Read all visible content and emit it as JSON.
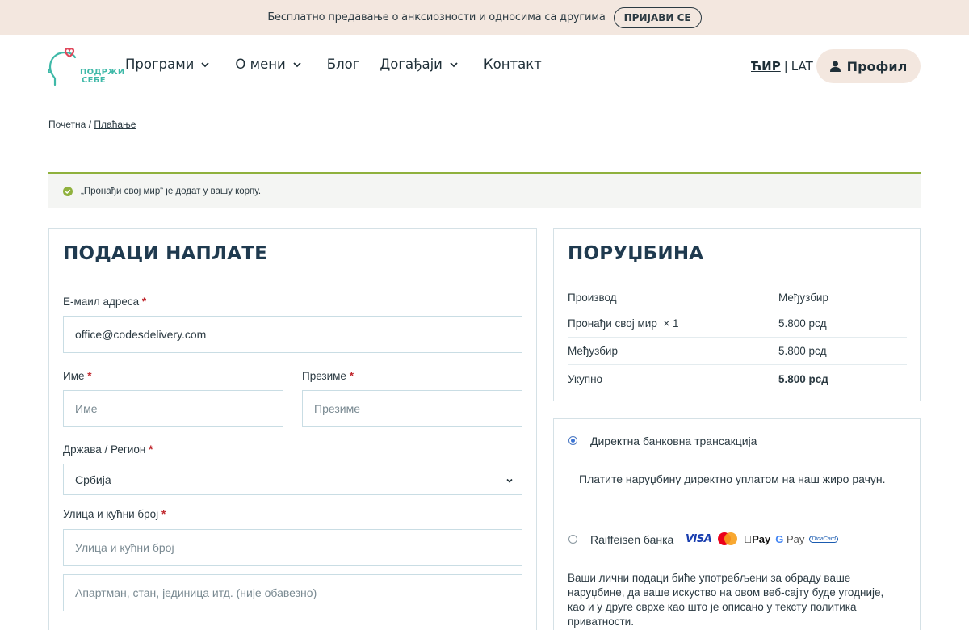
{
  "announcement": {
    "text": "Бесплатно предавање о анксиозности и односима са другима",
    "button": "ПРИЈАВИ СЕ"
  },
  "logo": {
    "line1": "ПОДРЖИ",
    "line2": "СЕБЕ"
  },
  "nav": [
    {
      "label": "Програми",
      "dropdown": true
    },
    {
      "label": "О мени",
      "dropdown": true
    },
    {
      "label": "Блог",
      "dropdown": false
    },
    {
      "label": "Догађаји",
      "dropdown": true
    },
    {
      "label": "Контакт",
      "dropdown": false
    }
  ],
  "lang": {
    "active": "ЋИР",
    "separator": "|",
    "other": "LAT"
  },
  "profile": {
    "label": "Профил",
    "icon": "user-icon"
  },
  "breadcrumb": {
    "home": "Почетна",
    "separator": "/",
    "current": "Плаћање"
  },
  "notice": {
    "text": "„Пронађи свој мир“ је додат у вашу корпу.",
    "icon": "check-circle-icon",
    "color": "#8fb13d"
  },
  "billing": {
    "title": "ПОДАЦИ НАПЛАТЕ",
    "email_label": "Е-маил адреса",
    "email_value": "office@codesdelivery.com",
    "first_name_label": "Име",
    "first_name_placeholder": "Име",
    "last_name_label": "Презиме",
    "last_name_placeholder": "Презиме",
    "country_label": "Држава / Регион",
    "country_value": "Србија",
    "street_label": "Улица и кућни број",
    "street_placeholder": "Улица и кућни број",
    "apartment_placeholder": "Апартман, стан, јединица итд. (није обавезно)",
    "required_mark": "*"
  },
  "order": {
    "title": "ПОРУЏБИНА",
    "header": {
      "product": "Производ",
      "subtotal": "Међузбир"
    },
    "items": [
      {
        "name": "Пронађи свој мир",
        "qty": "× 1",
        "price": "5.800 рсд"
      }
    ],
    "subtotal": {
      "label": "Међузбир",
      "value": "5.800 рсд"
    },
    "total": {
      "label": "Укупно",
      "value": "5.800 рсд"
    }
  },
  "payment": {
    "option1": {
      "label": "Директна банковна трансакција",
      "selected": true,
      "description": "Платите наруџбину директно уплатом на наш жиро рачун."
    },
    "option2": {
      "label": "Raiffeisen банка",
      "selected": false,
      "cards": {
        "visa": "VISA",
        "apple_pay": "Pay",
        "google_pay": "Pay",
        "diners": "DinaCard"
      }
    },
    "privacy": "Ваши лични подаци биће употребљени за обраду ваше наруџбине, да ваше искуство на овом веб-сајту буде угодније, као и у друге сврхе као што је описано у тексту политика приватности."
  },
  "colors": {
    "accent_bg": "#f3e7df",
    "brand_teal": "#3fb9a8",
    "heading": "#1f3a4f",
    "success": "#8fb13d"
  }
}
